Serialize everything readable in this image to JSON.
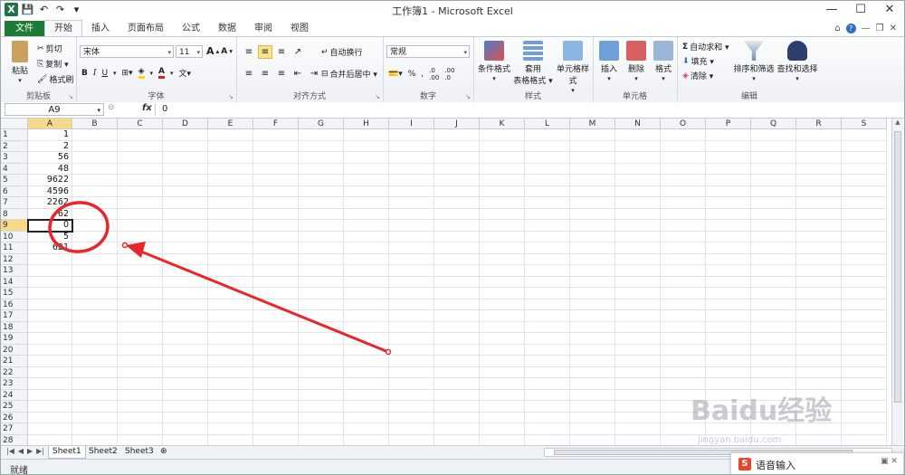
{
  "window": {
    "title": "工作簿1 - Microsoft Excel"
  },
  "tabs": [
    {
      "label": "文件"
    },
    {
      "label": "开始"
    },
    {
      "label": "插入"
    },
    {
      "label": "页面布局"
    },
    {
      "label": "公式"
    },
    {
      "label": "数据"
    },
    {
      "label": "审阅"
    },
    {
      "label": "视图"
    }
  ],
  "ribbon": {
    "clipboard": {
      "paste": "粘贴",
      "cut": "剪切",
      "copy": "复制 ▾",
      "format_painter": "格式刷",
      "label": "剪贴板"
    },
    "font": {
      "name": "宋体",
      "size": "11",
      "label": "字体"
    },
    "alignment": {
      "wrap": "自动换行",
      "merge": "合并后居中 ▾",
      "label": "对齐方式"
    },
    "number": {
      "format": "常规",
      "label": "数字"
    },
    "styles": {
      "conditional": "条件格式",
      "table_line1": "套用",
      "table_line2": "表格格式 ▾",
      "cell_styles": "单元格样式",
      "label": "样式"
    },
    "cells": {
      "insert": "插入",
      "delete": "删除",
      "format": "格式",
      "label": "单元格"
    },
    "editing": {
      "autosum": "自动求和 ▾",
      "fill": "填充 ▾",
      "clear": "清除 ▾",
      "sort": "排序和筛选",
      "find": "查找和选择",
      "label": "编辑"
    }
  },
  "formula_bar": {
    "name_box": "A9",
    "fx": "fx",
    "content": "0"
  },
  "columns": [
    "A",
    "B",
    "C",
    "D",
    "E",
    "F",
    "G",
    "H",
    "I",
    "J",
    "K",
    "L",
    "M",
    "N",
    "O",
    "P",
    "Q",
    "R",
    "S"
  ],
  "rows": [
    "1",
    "2",
    "3",
    "4",
    "5",
    "6",
    "7",
    "8",
    "9",
    "10",
    "11",
    "12",
    "13",
    "14",
    "15",
    "16",
    "17",
    "18",
    "19",
    "20",
    "21",
    "22",
    "23",
    "24",
    "25",
    "26",
    "27",
    "28"
  ],
  "cells_A": [
    "1",
    "2",
    "56",
    "48",
    "9622",
    "4596",
    "2262",
    "62",
    "0",
    "5",
    "621"
  ],
  "sheets": [
    {
      "name": "Sheet1"
    },
    {
      "name": "Sheet2"
    },
    {
      "name": "Sheet3"
    }
  ],
  "status": {
    "text": "就绪"
  },
  "ime": {
    "label": "语音输入"
  },
  "watermark": {
    "main": "Baidu经验",
    "sub": "jingyan.baidu.com"
  },
  "colors": {
    "accent": "#1e7a34",
    "selection": "#f8d98a",
    "annotation": "#e8262b"
  }
}
